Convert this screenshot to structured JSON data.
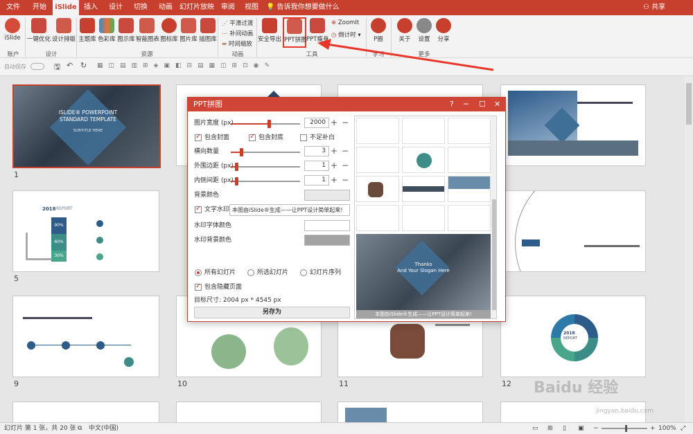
{
  "titlebar": {
    "tabs": [
      "文件",
      "开始",
      "iSlide",
      "插入",
      "设计",
      "切换",
      "动画",
      "幻灯片放映",
      "审阅",
      "视图"
    ],
    "active_tab": "iSlide",
    "tell_me": "告诉我你想要做什么",
    "share": "共享",
    "accent": "#c7402e"
  },
  "ribbon": {
    "islide": "iSlide",
    "account_group": "账户",
    "one_click": "一键优化",
    "design_layout": "设计排版",
    "design_group": "设计",
    "theme_lib": "主题库",
    "color_lib": "色彩库",
    "diagram_lib": "图示库",
    "smart_chart": "智能图表",
    "icon_lib": "图标库",
    "picture_lib": "图片库",
    "illustration_lib": "插图库",
    "resource_group": "资源",
    "smooth_transition": "平滑过渡",
    "tween_anim": "补间动画",
    "time_scale": "时间缩放",
    "animation_group": "动画",
    "safe_export": "安全导出",
    "ppt_collage": "PPT拼图",
    "ppt_slim": "PPT瘦身",
    "zoomit": "ZoomIt",
    "countdown": "倒计时",
    "tools_group": "工具",
    "p_circle": "P圈",
    "learn_group": "学习",
    "about": "关于",
    "settings": "设置",
    "share": "分享",
    "more_group": "更多"
  },
  "qat": {
    "autosave": "自动保存"
  },
  "slides": [
    {
      "num": "1",
      "title": "ISLIDE® POWERPOINT\nSTANDARD TEMPLATE",
      "subtitle": "SUBTITLE HERE"
    },
    {
      "num": "5",
      "year": "2018",
      "report": "REPORT",
      "p1": "90%",
      "p2": "60%",
      "p3": "30%"
    },
    {
      "num": "9"
    },
    {
      "num": "10"
    },
    {
      "num": "11"
    },
    {
      "num": "12",
      "year": "2018",
      "report": "REPORT"
    }
  ],
  "dialog": {
    "title": "PPT拼图",
    "help": "?",
    "image_width_label": "图片宽度 (px)",
    "image_width_value": "2000",
    "image_width_level": 0.55,
    "include_cover": "包含封面",
    "include_back": "包含封底",
    "no_fill": "不足补白",
    "horizontal_count_label": "横向数量",
    "horizontal_count_value": "3",
    "horizontal_level": 0.15,
    "outer_margin_label": "外围边距 (px)",
    "outer_margin_value": "1",
    "outer_level": 0.08,
    "inner_spacing_label": "内侧间距 (px)",
    "inner_spacing_value": "1",
    "inner_level": 0.08,
    "bg_color_label": "背景颜色",
    "watermark_label": "文字水印",
    "watermark_text": "本图由iSlide®生成——让PPT设计简单起来!",
    "watermark_font_color_label": "水印字体颜色",
    "watermark_bg_color_label": "水印背景颜色",
    "all_slides": "所有幻灯片",
    "selected_slides": "所选幻灯片",
    "slide_sequence": "幻灯片序列",
    "include_hidden": "包含隐藏页面",
    "target_size": "目标尺寸:  2004 px *  4545 px",
    "save_as": "另存为",
    "preview_thanks": "Thanks\nAnd Your Slogan Here",
    "preview_watermark": "本图由iSlide®生成——让PPT设计简单起来!"
  },
  "status": {
    "slide_info": "幻灯片 第 1 张，共 20 张",
    "language": "中文(中国)",
    "zoom": "100%"
  },
  "watermark_brand": "Baidu 经验",
  "watermark_url": "jingyan.baidu.com"
}
